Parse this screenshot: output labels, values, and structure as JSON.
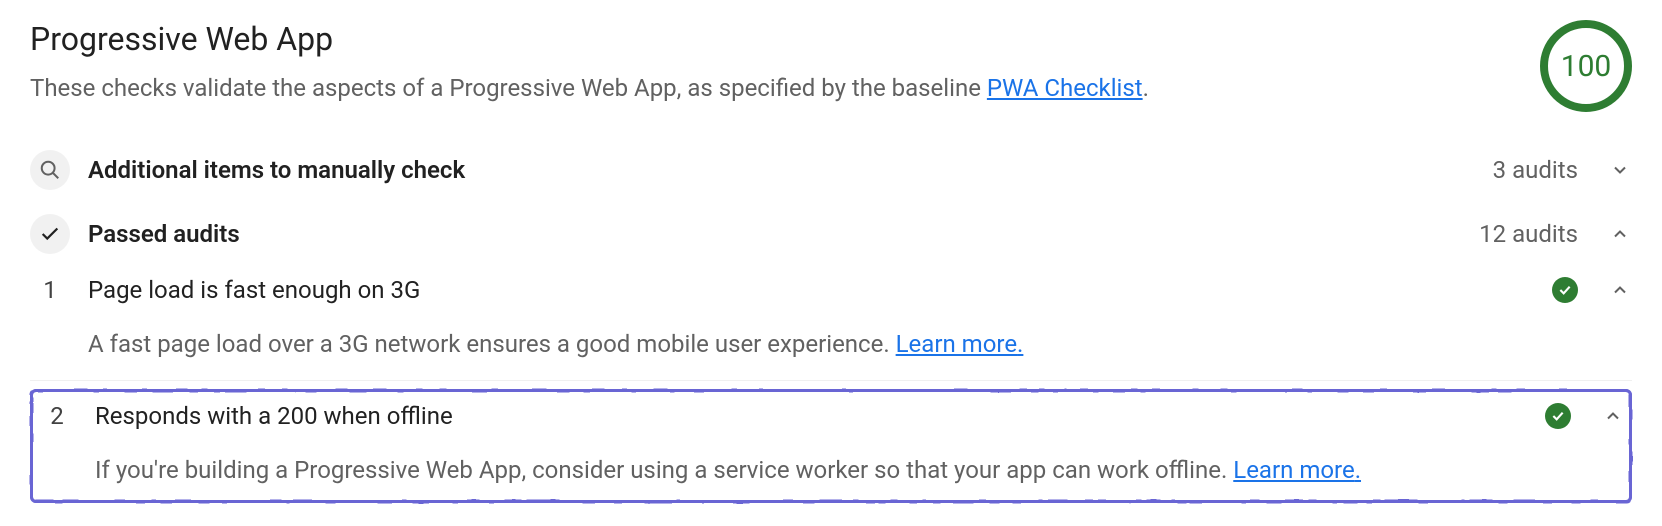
{
  "header": {
    "title": "Progressive Web App",
    "subtitle_prefix": "These checks validate the aspects of a Progressive Web App, as specified by the baseline ",
    "subtitle_link": "PWA Checklist",
    "subtitle_suffix": ".",
    "score": "100"
  },
  "sections": {
    "manual": {
      "label": "Additional items to manually check",
      "count": "3 audits"
    },
    "passed": {
      "label": "Passed audits",
      "count": "12 audits"
    }
  },
  "audits": [
    {
      "num": "1",
      "title": "Page load is fast enough on 3G",
      "desc_prefix": "A fast page load over a 3G network ensures a good mobile user experience. ",
      "learn_more": "Learn more"
    },
    {
      "num": "2",
      "title": "Responds with a 200 when offline",
      "desc_prefix": "If you're building a Progressive Web App, consider using a service worker so that your app can work offline. ",
      "learn_more": "Learn more"
    }
  ]
}
